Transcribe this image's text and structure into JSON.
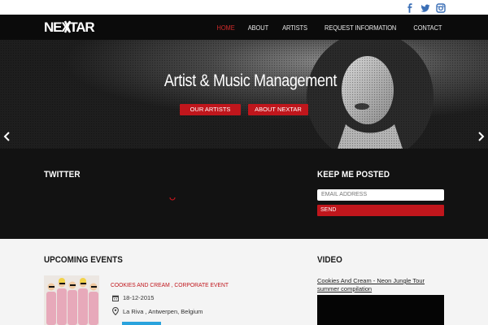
{
  "brand": {
    "logo_text": "NEXTAR"
  },
  "social": [
    {
      "icon": "facebook-icon"
    },
    {
      "icon": "twitter-icon"
    },
    {
      "icon": "instagram-icon"
    }
  ],
  "nav": {
    "items": [
      {
        "label": "HOME",
        "active": true
      },
      {
        "label": "ABOUT"
      },
      {
        "label": "ARTISTS"
      },
      {
        "label": "REQUEST INFORMATION"
      },
      {
        "label": "CONTACT"
      }
    ]
  },
  "hero": {
    "title": "Artist & Music Management",
    "buttons": [
      "OUR ARTISTS",
      "ABOUT NEXTAR"
    ]
  },
  "twitter": {
    "title": "TWITTER"
  },
  "newsletter": {
    "title": "KEEP ME POSTED",
    "email_placeholder": "EMAIL ADDRESS",
    "send_label": "SEND"
  },
  "events": {
    "title": "UPCOMING EVENTS",
    "items": [
      {
        "name": "COOKIES AND CREAM , CORPORATE EVENT",
        "date": "18-12-2015",
        "location": "La Riva , Antwerpen, Belgium"
      }
    ]
  },
  "video": {
    "title": "VIDEO",
    "link": "Cookies And Cream - Neon Jungle Tour summer compilation"
  },
  "colors": {
    "accent": "#c0161c",
    "nav_bg": "#0b0b0b",
    "dark_section": "#121212",
    "light_section": "#f4f4f4",
    "social_blue": "#3b6fb6"
  }
}
